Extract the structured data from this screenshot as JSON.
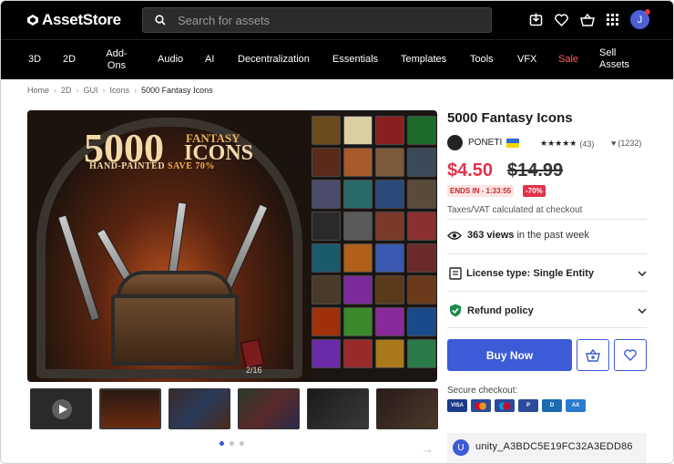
{
  "topbar": {
    "logo_text": "AssetStore",
    "search_placeholder": "Search for assets",
    "avatar_initial": "J"
  },
  "nav": {
    "items": [
      "3D",
      "2D",
      "Add-Ons",
      "Audio",
      "AI",
      "Decentralization",
      "Essentials",
      "Templates",
      "Tools",
      "VFX",
      "Sale",
      "Sell Assets"
    ]
  },
  "breadcrumb": [
    "Home",
    "2D",
    "GUI",
    "Icons",
    "5000 Fantasy Icons"
  ],
  "hero": {
    "big_number": "5000",
    "word_fantasy": "FANTASY",
    "word_icons": "ICONS",
    "subtitle": "HAND-PAINTED",
    "save": "SAVE 70%",
    "counter": "2/16"
  },
  "product": {
    "title": "5000 Fantasy Icons",
    "publisher": "PONETI",
    "stars": "★★★★★",
    "rating_count": "(43)",
    "fav_count": "(1232)",
    "price": "$4.50",
    "old_price": "$14.99",
    "ends_in": "ENDS IN - 1:33:55",
    "discount": "-70%",
    "vat_note": "Taxes/VAT calculated at checkout",
    "views_count": "363 views",
    "views_suffix": "in the past week",
    "license_label": "License type: Single Entity",
    "refund_label": "Refund policy",
    "buy_label": "Buy Now",
    "secure_label": "Secure checkout:",
    "payment_cards": [
      "VISA",
      "MC",
      "Maestro",
      "PayPal",
      "Diners",
      "AMEX"
    ],
    "coupon_code": "unity_A3BDC5E19FC32A3EDD86"
  },
  "colors": {
    "accent": "#3c5bd6",
    "sale_red": "#e0344b",
    "nav_bg": "#000000"
  }
}
